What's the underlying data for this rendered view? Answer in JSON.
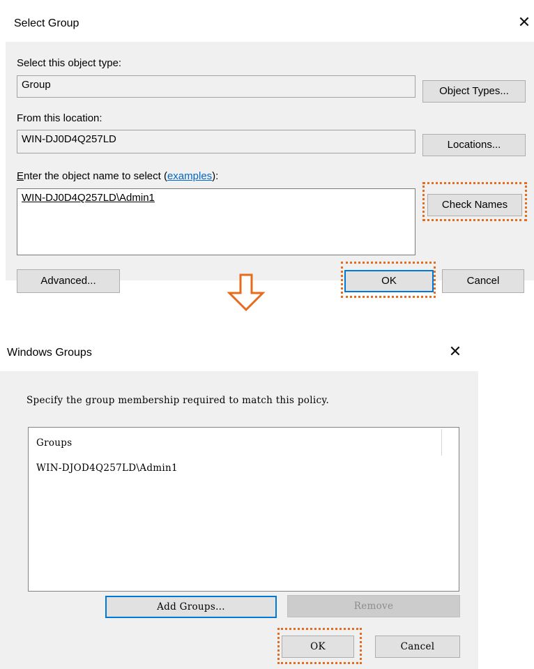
{
  "select_group": {
    "title": "Select Group",
    "object_type_label": "Select this object type:",
    "object_type_value": "Group",
    "object_types_button": "Object Types...",
    "location_label": "From this location:",
    "location_value": "WIN-DJ0D4Q257LD",
    "locations_button": "Locations...",
    "enter_name_label_e": "E",
    "enter_name_label_rest": "nter the object name to select (",
    "examples_link": "examples",
    "enter_name_label_end": "):",
    "object_name_value": "WIN-DJ0D4Q257LD\\Admin1",
    "check_names_button": "Check Names",
    "advanced_button": "Advanced...",
    "ok_button": "OK",
    "cancel_button": "Cancel"
  },
  "windows_groups": {
    "title": "Windows Groups",
    "instruction": "Specify the group membership required to match this policy.",
    "list_header": "Groups",
    "list_items": [
      "WIN-DJOD4Q257LD\\Admin1"
    ],
    "add_groups_button": "Add Groups...",
    "remove_button": "Remove",
    "ok_button": "OK",
    "cancel_button": "Cancel"
  },
  "highlight_color": "#e46c1c",
  "arrow_color": "#e46c1c",
  "icons": [
    "close-icon",
    "down-arrow-icon"
  ]
}
